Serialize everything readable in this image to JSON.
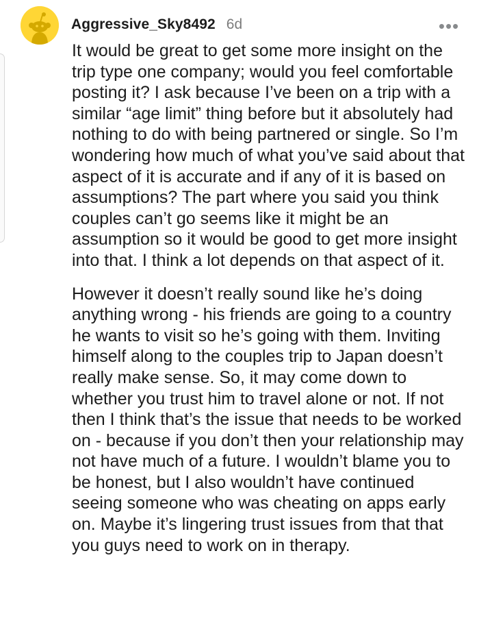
{
  "comment": {
    "author": "Aggressive_Sky8492",
    "age": "6d",
    "more_options_icon": "more-horizontal-icon",
    "avatar_icon": "reddit-snoo-avatar-icon",
    "colors": {
      "avatar_background": "#ffd635",
      "text": "#1c1c1c",
      "muted": "#7c7c7c"
    },
    "paragraphs": [
      "It would be great to get some more insight on the trip type one company; would you feel comfortable posting it? I ask because I’ve been on a trip with a similar “age limit” thing before but it absolutely had nothing to do with being partnered or single. So I’m wondering how much of what you’ve said about that aspect of it is accurate and if any of it is based on assumptions? The part where you said you think couples can’t go seems like it might be an assumption so it would be good to get more insight into that. I think a lot depends on that aspect of it.",
      "However it doesn’t really sound like he’s doing anything wrong - his friends are going to a country he wants to visit so he’s going with them. Inviting himself along to the couples trip to Japan doesn’t really make sense. So, it may come down to whether you trust him to travel alone or not. If not then I think that’s the issue that needs to be worked on - because if you don’t then your relationship may not have much of a future. I wouldn’t blame you to be honest, but I also wouldn’t have continued seeing someone who was cheating on apps early on. Maybe it’s lingering trust issues from that that you guys need to work on in therapy."
    ]
  }
}
